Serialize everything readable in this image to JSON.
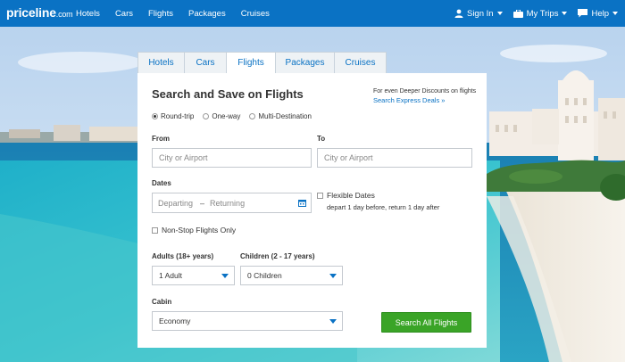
{
  "topbar": {
    "logo_main": "priceline",
    "logo_suffix": ".com",
    "nav": [
      "Hotels",
      "Cars",
      "Flights",
      "Packages",
      "Cruises"
    ],
    "signin": "Sign In",
    "mytrips": "My Trips",
    "help": "Help",
    "bg_color": "#0a72c4"
  },
  "tabs": [
    {
      "label": "Hotels",
      "active": false
    },
    {
      "label": "Cars",
      "active": false
    },
    {
      "label": "Flights",
      "active": true
    },
    {
      "label": "Packages",
      "active": false
    },
    {
      "label": "Cruises",
      "active": false
    }
  ],
  "form": {
    "title": "Search and Save on Flights",
    "promo_line1": "For even Deeper Discounts on flights",
    "promo_line2": "Search Express Deals »",
    "trip_types": [
      {
        "label": "Round-trip",
        "selected": true
      },
      {
        "label": "One-way",
        "selected": false
      },
      {
        "label": "Multi-Destination",
        "selected": false
      }
    ],
    "from_label": "From",
    "from_placeholder": "City or Airport",
    "to_label": "To",
    "to_placeholder": "City or Airport",
    "dates_label": "Dates",
    "departing": "Departing",
    "dash": "–",
    "returning": "Returning",
    "flexible_label": "Flexible Dates",
    "flexible_note": "depart 1 day before, return 1 day after",
    "nonstop_label": "Non-Stop Flights Only",
    "adults_label": "Adults (18+ years)",
    "adults_value": "1 Adult",
    "children_label": "Children (2 - 17 years)",
    "children_value": "0 Children",
    "cabin_label": "Cabin",
    "cabin_value": "Economy",
    "search_button": "Search All Flights",
    "button_color": "#3aa427"
  }
}
